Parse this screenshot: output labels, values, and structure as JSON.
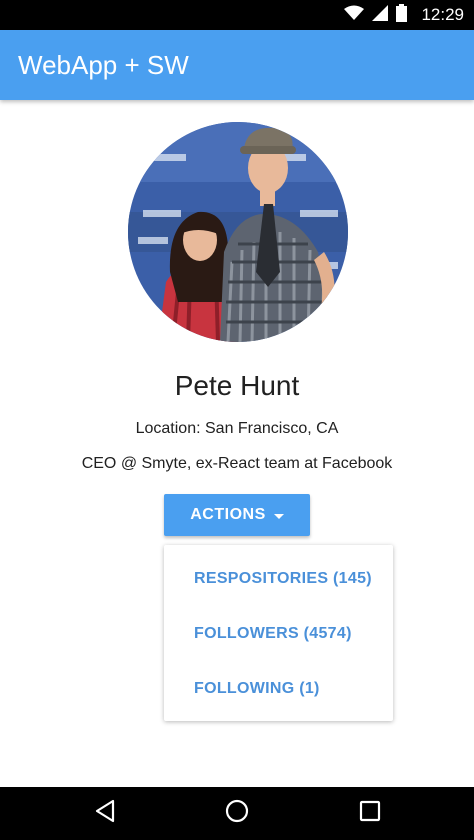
{
  "status_bar": {
    "time": "12:29",
    "icons": [
      "wifi-icon",
      "cellular-signal-icon",
      "battery-icon"
    ]
  },
  "app_bar": {
    "title": "WebApp + SW",
    "color": "#4a9ff0"
  },
  "profile": {
    "avatar_icon": "profile-photo",
    "name": "Pete Hunt",
    "location": "Location: San Francisco, CA",
    "bio": "CEO @ Smyte, ex-React team at Facebook"
  },
  "actions": {
    "button_label": "ACTIONS",
    "menu_items": [
      {
        "label": "RESPOSITORIES (145)"
      },
      {
        "label": "FOLLOWERS (4574)"
      },
      {
        "label": "FOLLOWING (1)"
      }
    ]
  },
  "nav_bar": {
    "icons": [
      "back-icon",
      "home-icon",
      "recents-icon"
    ]
  },
  "colors": {
    "accent": "#4a9ff0",
    "menu_text": "#4a90d9"
  }
}
